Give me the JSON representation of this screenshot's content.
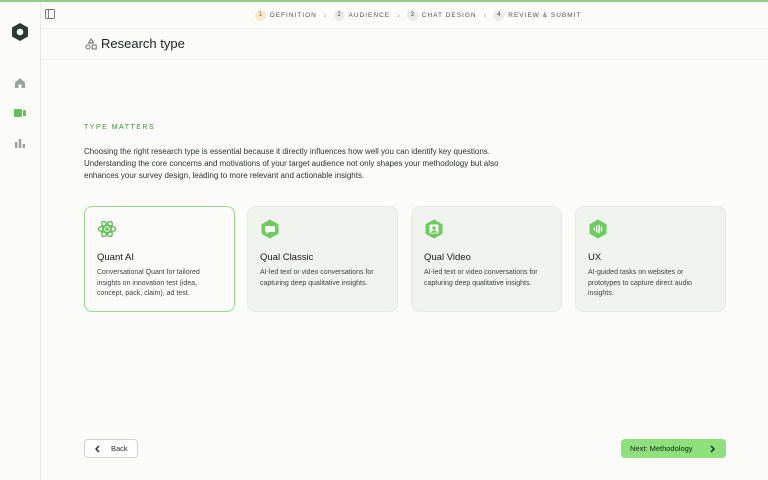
{
  "stepper": {
    "steps": [
      {
        "num": "1",
        "label": "Definition"
      },
      {
        "num": "2",
        "label": "Audience"
      },
      {
        "num": "3",
        "label": "Chat Design"
      },
      {
        "num": "4",
        "label": "Review & Submit"
      }
    ]
  },
  "header": {
    "title": "Research type"
  },
  "main": {
    "section_label": "Type matters",
    "description": "Choosing the right research type is essential because it directly influences how well you can identify key questions. Understanding the core concerns and motivations of your target audience not only shapes your methodology but also enhances your survey design, leading to more relevant and actionable insights.",
    "cards": [
      {
        "title": "Quant AI",
        "desc": "Conversational Quant for tailored insights on innovation test (idea, concept, pack, claim), ad test.",
        "icon": "atom-icon"
      },
      {
        "title": "Qual Classic",
        "desc": "AI-led text or video conversations for capturing deep qualitative insights.",
        "icon": "chat-bubble-icon"
      },
      {
        "title": "Qual Video",
        "desc": "AI-led text or video conversations for capturing deep qualitative insights.",
        "icon": "video-person-icon"
      },
      {
        "title": "UX",
        "desc": "AI-guided tasks on websites or prototypes to capture direct audio insights.",
        "icon": "audio-wave-icon"
      }
    ]
  },
  "footer": {
    "back_label": "Back",
    "next_label": "Next: Methodology"
  },
  "colors": {
    "accent": "#8ee07c",
    "label_green": "#3f8f3a",
    "active_step": "#f6e9c9"
  }
}
